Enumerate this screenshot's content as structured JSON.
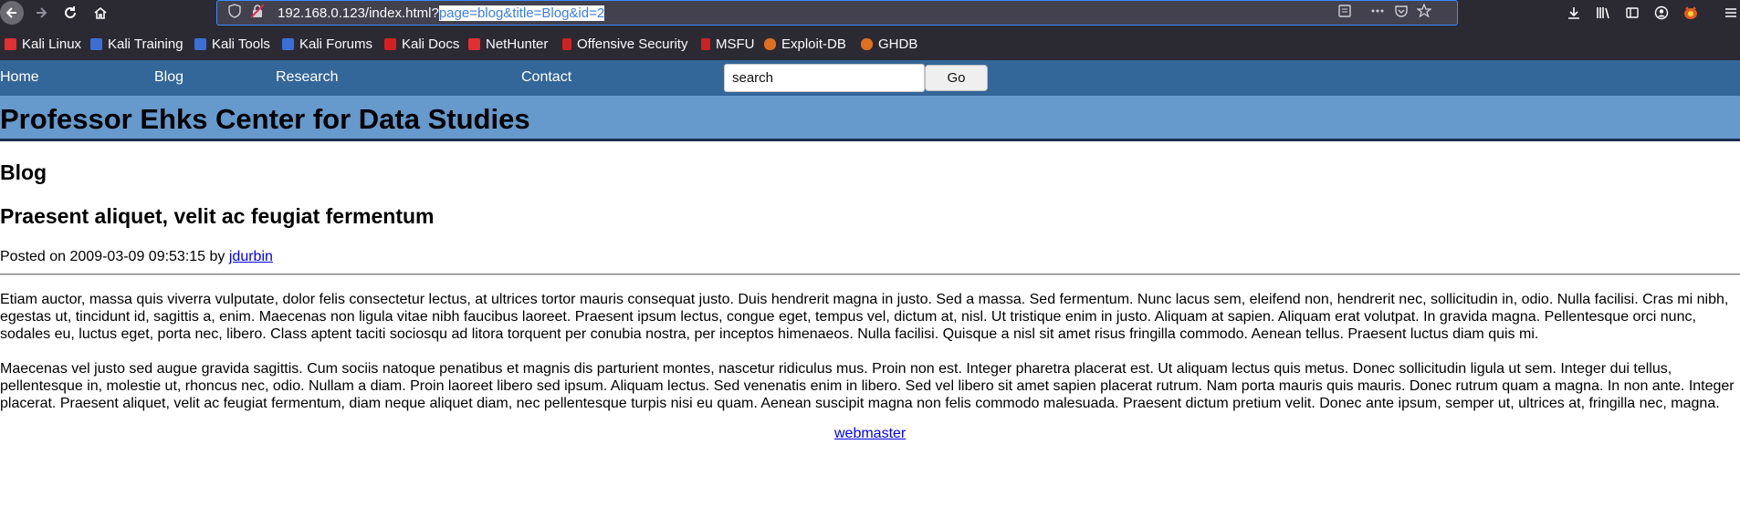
{
  "browser": {
    "url_base": "192.168.0.123/index.html?",
    "url_query": "page=blog&title=Blog&id=2",
    "icons": {
      "back": "back-arrow-icon",
      "forward": "forward-arrow-icon",
      "reload": "reload-icon",
      "home": "home-icon",
      "shield": "tracking-shield-icon",
      "insecure": "insecure-lock-icon",
      "reader": "reader-view-icon",
      "more": "more-icon",
      "pocket": "pocket-icon",
      "star": "bookmark-star-icon",
      "downloads": "downloads-icon",
      "library": "library-icon",
      "sidebar": "sidebar-icon",
      "account": "account-icon",
      "extension": "extension-icon",
      "menu": "hamburger-menu-icon"
    },
    "bookmarks": [
      {
        "label": "Kali Linux",
        "color": "#e03030"
      },
      {
        "label": "Kali Training",
        "color": "#3b6fd6"
      },
      {
        "label": "Kali Tools",
        "color": "#3b6fd6"
      },
      {
        "label": "Kali Forums",
        "color": "#3b6fd6"
      },
      {
        "label": "Kali Docs",
        "color": "#d42020"
      },
      {
        "label": "NetHunter",
        "color": "#e03030"
      },
      {
        "label": "Offensive Security",
        "color": "#cc2222"
      },
      {
        "label": "MSFU",
        "color": "#cc2222"
      },
      {
        "label": "Exploit-DB",
        "color": "#e07020"
      },
      {
        "label": "GHDB",
        "color": "#e07020"
      }
    ]
  },
  "site": {
    "nav": {
      "home": "Home",
      "blog": "Blog",
      "research": "Research",
      "contact": "Contact",
      "search_value": "search",
      "go_label": "Go"
    },
    "title": "Professor Ehks Center for Data Studies",
    "nav_color": "#336699",
    "header_color": "#6699cc"
  },
  "content": {
    "section": "Blog",
    "post_title": "Praesent aliquet, velit ac feugiat fermentum",
    "posted_prefix": "Posted on 2009-03-09 09:53:15 by ",
    "author": "jdurbin",
    "paragraphs": [
      "Etiam auctor, massa quis viverra vulputate, dolor felis consectetur lectus, at ultrices tortor mauris consequat justo. Duis hendrerit magna in justo. Sed a massa. Sed fermentum. Nunc lacus sem, eleifend non, hendrerit nec, sollicitudin in, odio. Nulla facilisi. Cras mi nibh, egestas ut, tincidunt id, sagittis a, enim. Maecenas non ligula vitae nibh faucibus laoreet. Praesent ipsum lectus, congue eget, tempus vel, dictum at, nisl. Ut tristique enim in justo. Aliquam at sapien. Aliquam erat volutpat. In gravida magna. Pellentesque orci nunc, sodales eu, luctus eget, porta nec, libero. Class aptent taciti sociosqu ad litora torquent per conubia nostra, per inceptos himenaeos. Nulla facilisi. Quisque a nisl sit amet risus fringilla commodo. Aenean tellus. Praesent luctus diam quis mi.",
      "Maecenas vel justo sed augue gravida sagittis. Cum sociis natoque penatibus et magnis dis parturient montes, nascetur ridiculus mus. Proin non est. Integer pharetra placerat est. Ut aliquam lectus quis metus. Donec sollicitudin ligula ut sem. Integer dui tellus, pellentesque in, molestie ut, rhoncus nec, odio. Nullam a diam. Proin laoreet libero sed ipsum. Aliquam lectus. Sed venenatis enim in libero. Sed vel libero sit amet sapien placerat rutrum. Nam porta mauris quis mauris. Donec rutrum quam a magna. In non ante. Integer placerat. Praesent aliquet, velit ac feugiat fermentum, diam neque aliquet diam, nec pellentesque turpis nisi eu quam. Aenean suscipit magna non felis commodo malesuada. Praesent dictum pretium velit. Donec ante ipsum, semper ut, ultrices at, fringilla nec, magna."
    ],
    "footer_link": "webmaster"
  }
}
